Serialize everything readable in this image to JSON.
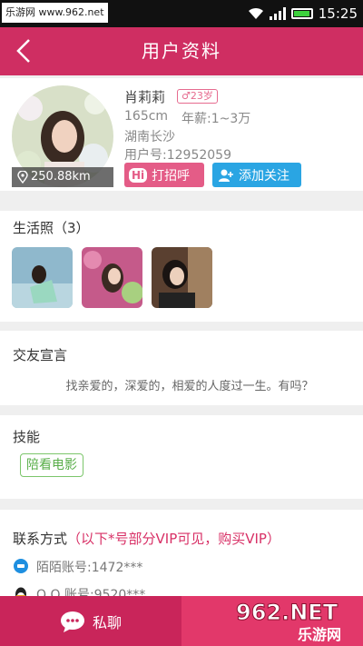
{
  "statusbar": {
    "site": "乐游网 www.962.net",
    "time": "15:25"
  },
  "header": {
    "title": "用户资料"
  },
  "profile": {
    "name": "肖莉莉",
    "age_badge": "♂23岁",
    "height": "165cm",
    "income": "年薪:1~3万",
    "location": "湖南长沙",
    "user_id": "用户号:12952059",
    "distance": "250.88km",
    "greet_hi": "Hi",
    "greet_label": "打招呼",
    "follow_label": "添加关注"
  },
  "photos": {
    "title": "生活照（3）"
  },
  "declaration": {
    "title": "交友宣言",
    "text": "找亲爱的，深爱的，相爱的人度过一生。有吗？"
  },
  "skills": {
    "title": "技能",
    "tags": [
      "陪看电影"
    ]
  },
  "contact": {
    "title": "联系方式",
    "vip_note": "（以下*号部分VIP可见，购买VIP）",
    "rows": [
      {
        "icon": "momo-icon",
        "text": "陌陌账号:1472***"
      },
      {
        "icon": "qq-icon",
        "text": "Q Q 账号:9520***"
      }
    ]
  },
  "bottom": {
    "chat_label": "私聊"
  },
  "watermark": {
    "top": "962.NET",
    "bottom": "乐游网"
  },
  "colors": {
    "header": "#cf2e62",
    "greet": "#e45c87",
    "follow": "#2aa5e3",
    "skill": "#7cc66b",
    "vip": "#d83066"
  }
}
